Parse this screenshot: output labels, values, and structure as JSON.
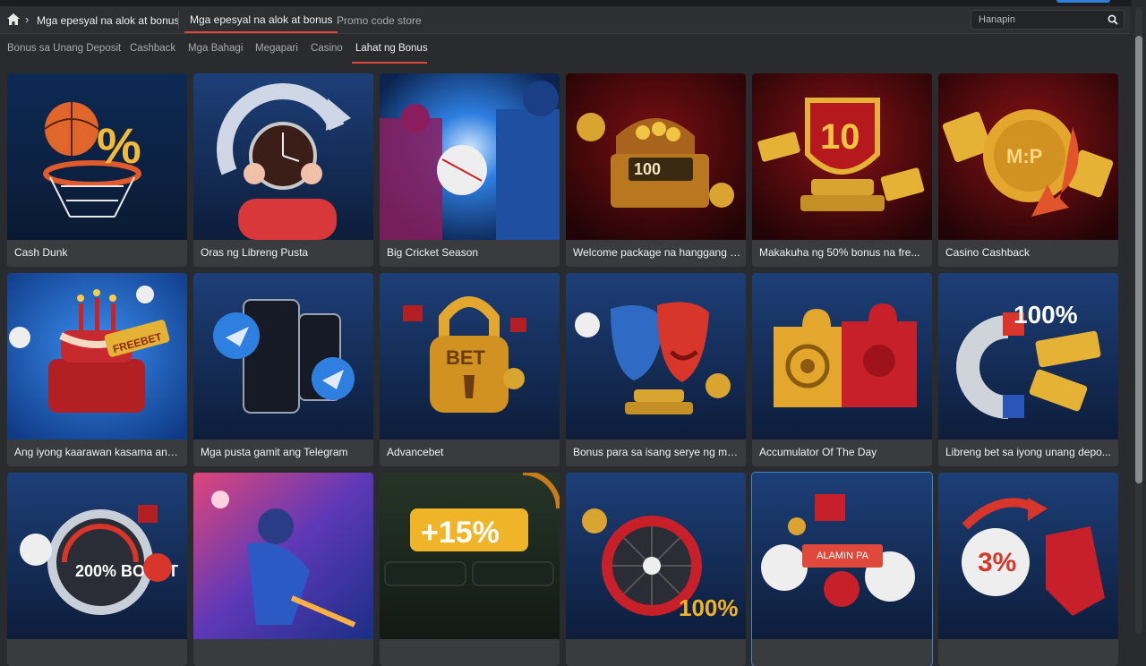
{
  "breadcrumb": {
    "level1": "Mga epesyal na alok at bonus",
    "level2": "Mga epesyal na alok at bonus",
    "level3": "Promo code store"
  },
  "search": {
    "placeholder": "Hanapin"
  },
  "tabs": [
    {
      "label": "Bonus sa Unang Deposit"
    },
    {
      "label": "Cashback"
    },
    {
      "label": "Mga Bahagi"
    },
    {
      "label": "Megapari"
    },
    {
      "label": "Casino"
    },
    {
      "label": "Lahat ng Bonus",
      "active": true
    }
  ],
  "cards": [
    {
      "title": "Cash Dunk",
      "icon": "basketball-percent-icon",
      "tile_text": "%"
    },
    {
      "title": "Oras ng Libreng Pusta",
      "icon": "clock-icon"
    },
    {
      "title": "Big Cricket Season",
      "icon": "cricket-icon"
    },
    {
      "title": "Welcome package na hanggang 1...",
      "icon": "treasure-chest-icon",
      "tile_text": "100"
    },
    {
      "title": "Makakuha ng 50% bonus na fre...",
      "icon": "trophy-icon",
      "tile_text": "10"
    },
    {
      "title": "Casino Cashback",
      "icon": "coin-icon",
      "tile_text": "M:P"
    },
    {
      "title": "Ang iyong kaarawan kasama ang M...",
      "icon": "birthday-cake-icon",
      "tile_text": "FREEBET"
    },
    {
      "title": "Mga pusta gamit ang Telegram",
      "icon": "telegram-phone-icon"
    },
    {
      "title": "Advancebet",
      "icon": "padlock-icon",
      "tile_text": "BET"
    },
    {
      "title": "Bonus para sa isang serye ng mg...",
      "icon": "theatre-masks-icon"
    },
    {
      "title": "Accumulator Of The Day",
      "icon": "puzzle-icon"
    },
    {
      "title": "Libreng bet sa iyong unang depo...",
      "icon": "magnet-icon",
      "tile_text": "100%"
    },
    {
      "title": "",
      "icon": "speedometer-icon",
      "tile_text": "200% BOOST"
    },
    {
      "title": "",
      "icon": "cricket-player-icon"
    },
    {
      "title": "",
      "icon": "upi-jeton-icon",
      "tile_text": "+15%"
    },
    {
      "title": "",
      "icon": "wheel-icon",
      "tile_text": "100%"
    },
    {
      "title": "",
      "icon": "football-gift-icon",
      "button": "ALAMIN PA"
    },
    {
      "title": "",
      "icon": "goalkeeper-glove-icon",
      "tile_text": "3%"
    }
  ],
  "colors": {
    "accent": "#e0483b",
    "background": "#2a2b2e",
    "card": "#3a3b3f"
  }
}
